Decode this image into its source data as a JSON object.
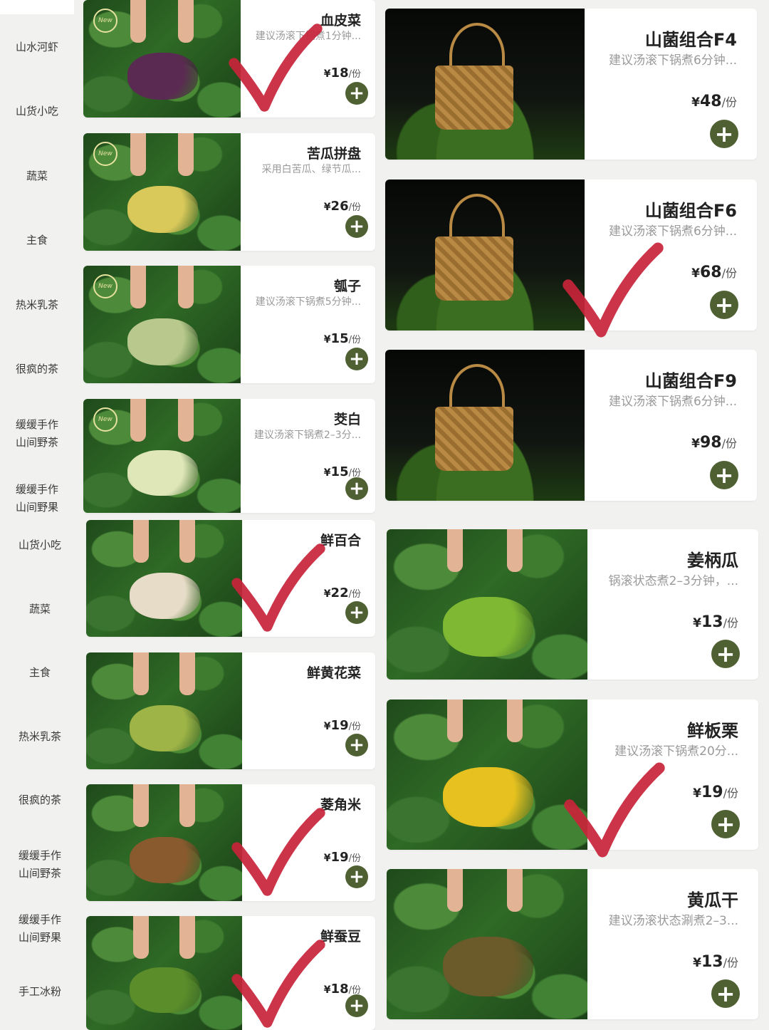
{
  "sidebar": {
    "items": [
      {
        "label": "山水河虾"
      },
      {
        "label": "山货小吃"
      },
      {
        "label": "蔬菜"
      },
      {
        "label": "主食"
      },
      {
        "label": "热米乳茶"
      },
      {
        "label": "很疯的茶"
      },
      {
        "label": "缓缓手作\n山间野茶"
      },
      {
        "label": "缓缓手作\n山间野果"
      },
      {
        "label": "山货小吃"
      },
      {
        "label": "蔬菜"
      },
      {
        "label": "主食"
      },
      {
        "label": "热米乳茶"
      },
      {
        "label": "很疯的茶"
      },
      {
        "label": "缓缓手作\n山间野茶"
      },
      {
        "label": "缓缓手作\n山间野果"
      },
      {
        "label": "手工冰粉"
      }
    ]
  },
  "badge_text": "New",
  "add_symbol": "+",
  "currency": "¥",
  "unit": "/份",
  "left_products": [
    {
      "name": "血皮菜",
      "desc": "建议汤滚下锅煮1分钟...",
      "price": "18",
      "badge": true,
      "checked": true
    },
    {
      "name": "苦瓜拼盘",
      "desc": "采用白苦瓜、绿节瓜...",
      "price": "26",
      "badge": true,
      "checked": false
    },
    {
      "name": "瓠子",
      "desc": "建议汤滚下锅煮5分钟...",
      "price": "15",
      "badge": true,
      "checked": false
    },
    {
      "name": "茭白",
      "desc": "建议汤滚下锅煮2–3分...",
      "price": "15",
      "badge": true,
      "checked": false
    },
    {
      "name": "鲜百合",
      "desc": "",
      "price": "22",
      "badge": false,
      "checked": true
    },
    {
      "name": "鲜黄花菜",
      "desc": "",
      "price": "19",
      "badge": false,
      "checked": false
    },
    {
      "name": "菱角米",
      "desc": "",
      "price": "19",
      "badge": false,
      "checked": true
    },
    {
      "name": "鲜蚕豆",
      "desc": "",
      "price": "18",
      "badge": false,
      "checked": true
    }
  ],
  "right_products": [
    {
      "name": "山菌组合F4",
      "desc": "建议汤滚下锅煮6分钟...",
      "price": "48",
      "checked": false
    },
    {
      "name": "山菌组合F6",
      "desc": "建议汤滚下锅煮6分钟...",
      "price": "68",
      "checked": true
    },
    {
      "name": "山菌组合F9",
      "desc": "建议汤滚下锅煮6分钟...",
      "price": "98",
      "checked": false
    },
    {
      "name": "姜柄瓜",
      "desc": "锅滚状态煮2–3分钟，...",
      "price": "13",
      "checked": false
    },
    {
      "name": "鲜板栗",
      "desc": "建议汤滚下锅煮20分...",
      "price": "19",
      "checked": true
    },
    {
      "name": "黄瓜干",
      "desc": "建议汤滚状态涮煮2–3...",
      "price": "13",
      "checked": false
    }
  ],
  "colors": {
    "add_button": "#4f6133",
    "check_mark": "#c8243a",
    "background": "#f1f1ef"
  },
  "icons": {
    "add": "plus-circle-icon",
    "check": "red-check-mark",
    "new": "new-badge-icon"
  }
}
